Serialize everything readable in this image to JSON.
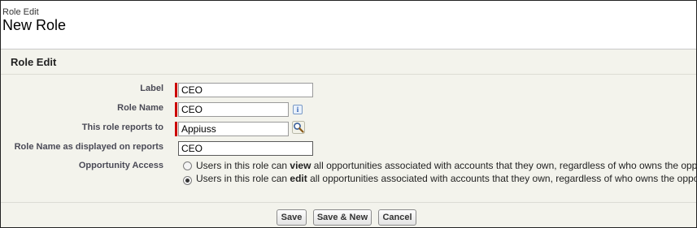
{
  "page": {
    "type_label": "Role Edit",
    "title": "New Role"
  },
  "panel": {
    "title": "Role Edit"
  },
  "form": {
    "label": {
      "label": "Label",
      "value": "CEO"
    },
    "role_name": {
      "label": "Role Name",
      "value": "CEO"
    },
    "reports_to": {
      "label": "This role reports to",
      "value": "Appiuss"
    },
    "display_name": {
      "label": "Role Name as displayed on reports",
      "value": "CEO"
    },
    "opportunity_access": {
      "label": "Opportunity Access",
      "options": [
        {
          "pre": "Users in this role can ",
          "bold": "view",
          "post": " all opportunities associated with accounts that they own, regardless of who owns the opportunities",
          "selected": false
        },
        {
          "pre": "Users in this role can ",
          "bold": "edit",
          "post": " all opportunities associated with accounts that they own, regardless of who owns the opportunities",
          "selected": true
        }
      ]
    }
  },
  "icons": {
    "info": "info-icon",
    "info_glyph": "i",
    "lookup": "lookup-magnifier-icon"
  },
  "buttons": {
    "save": "Save",
    "save_new": "Save & New",
    "cancel": "Cancel"
  },
  "colors": {
    "required_bar": "#cc0000",
    "panel_bg": "#f3f3ec"
  }
}
